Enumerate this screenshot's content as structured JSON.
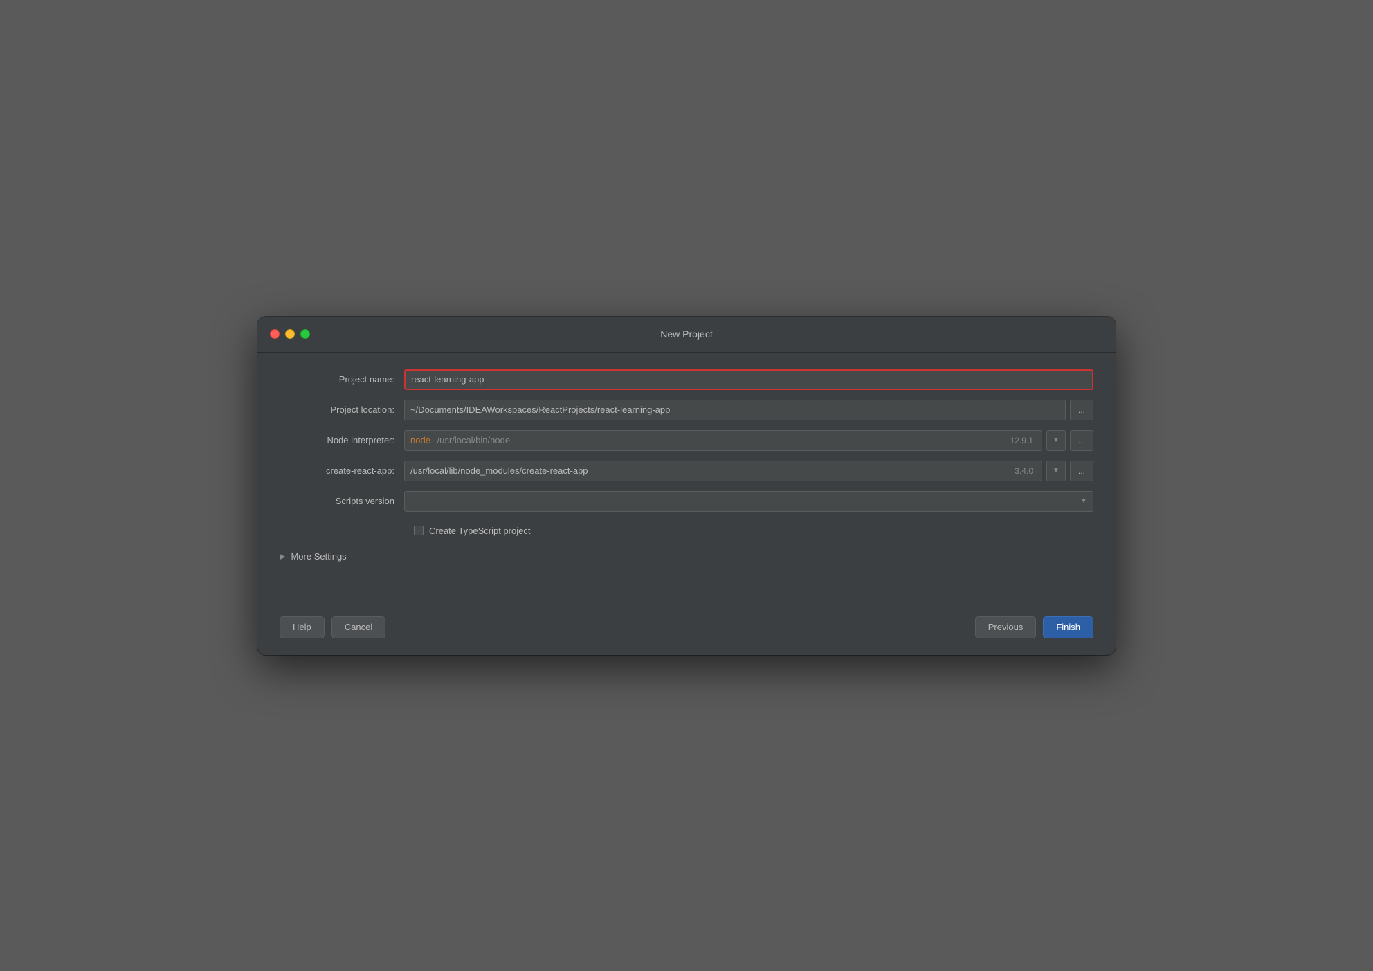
{
  "window": {
    "title": "New Project",
    "traffic_lights": {
      "close_label": "close",
      "minimize_label": "minimize",
      "maximize_label": "maximize"
    }
  },
  "form": {
    "project_name_label": "Project name:",
    "project_name_value": "react-learning-app",
    "project_location_label": "Project location:",
    "project_location_value": "~/Documents/IDEAWorkspaces/ReactProjects/react-learning-app",
    "node_interpreter_label": "Node interpreter:",
    "node_interpreter_keyword": "node",
    "node_interpreter_path": "/usr/local/bin/node",
    "node_interpreter_version": "12.9.1",
    "create_react_app_label": "create-react-app:",
    "create_react_app_value": "/usr/local/lib/node_modules/create-react-app",
    "create_react_app_version": "3.4.0",
    "scripts_version_label": "Scripts version",
    "typescript_label": "Create TypeScript project",
    "browse_label": "...",
    "more_settings_label": "More Settings"
  },
  "buttons": {
    "help_label": "Help",
    "cancel_label": "Cancel",
    "previous_label": "Previous",
    "finish_label": "Finish"
  }
}
